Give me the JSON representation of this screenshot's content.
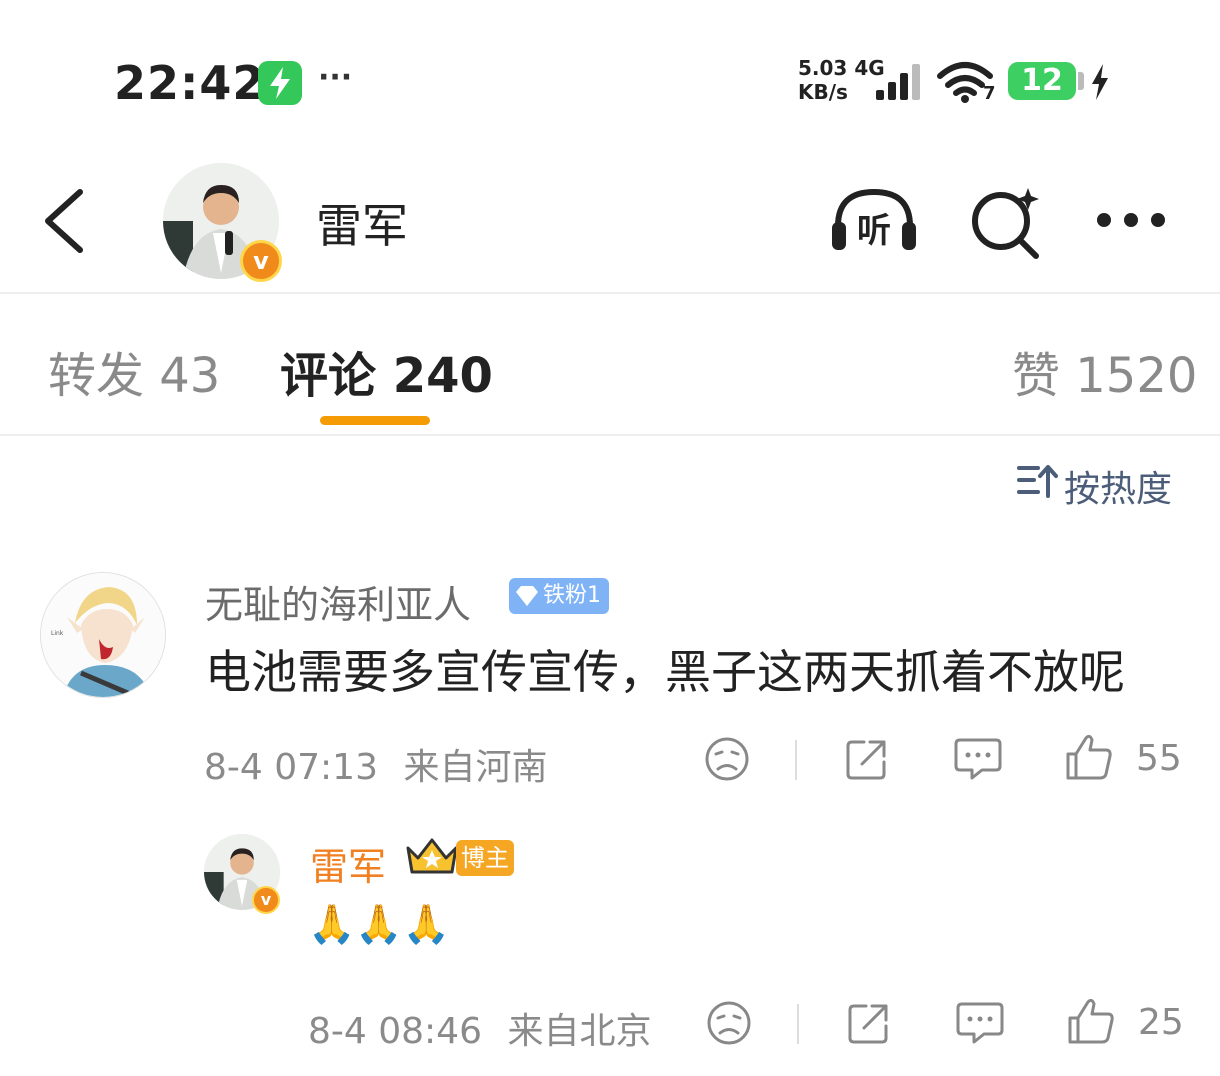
{
  "status_bar": {
    "time": "22:42",
    "dots": "···",
    "net_speed_value": "5.03",
    "net_speed_unit": "KB/s",
    "network_type": "4G",
    "wifi_level": "7",
    "battery_level": "12"
  },
  "header": {
    "title": "雷军"
  },
  "tabs": {
    "repost": "转发 43",
    "comments": "评论 240",
    "likes": "赞 1520"
  },
  "sort": {
    "label": "按热度"
  },
  "comments": [
    {
      "username": "无耻的海利亚人",
      "fan_badge": "铁粉1",
      "content": "电池需要多宣传宣传，黑子这两天抓着不放呢",
      "date_time": "8-4 07:13",
      "location": "来自河南",
      "likes": "55",
      "reply": {
        "username": "雷军",
        "author_badge": "博主",
        "content": "🙏🙏🙏",
        "date_time": "8-4 08:46",
        "location": "来自北京",
        "likes": "25"
      }
    }
  ],
  "colors": {
    "accent_orange": "#f59b06",
    "author_name": "#f08022",
    "sort_text": "#4b5d78",
    "fan_badge_bg": "#7fb3f6"
  },
  "icons": [
    "back-arrow-icon",
    "headphone-listen-icon",
    "search-sparkle-icon",
    "more-icon",
    "sort-icon",
    "dislike-face-icon",
    "share-icon",
    "reply-bubble-icon",
    "thumb-up-icon"
  ]
}
